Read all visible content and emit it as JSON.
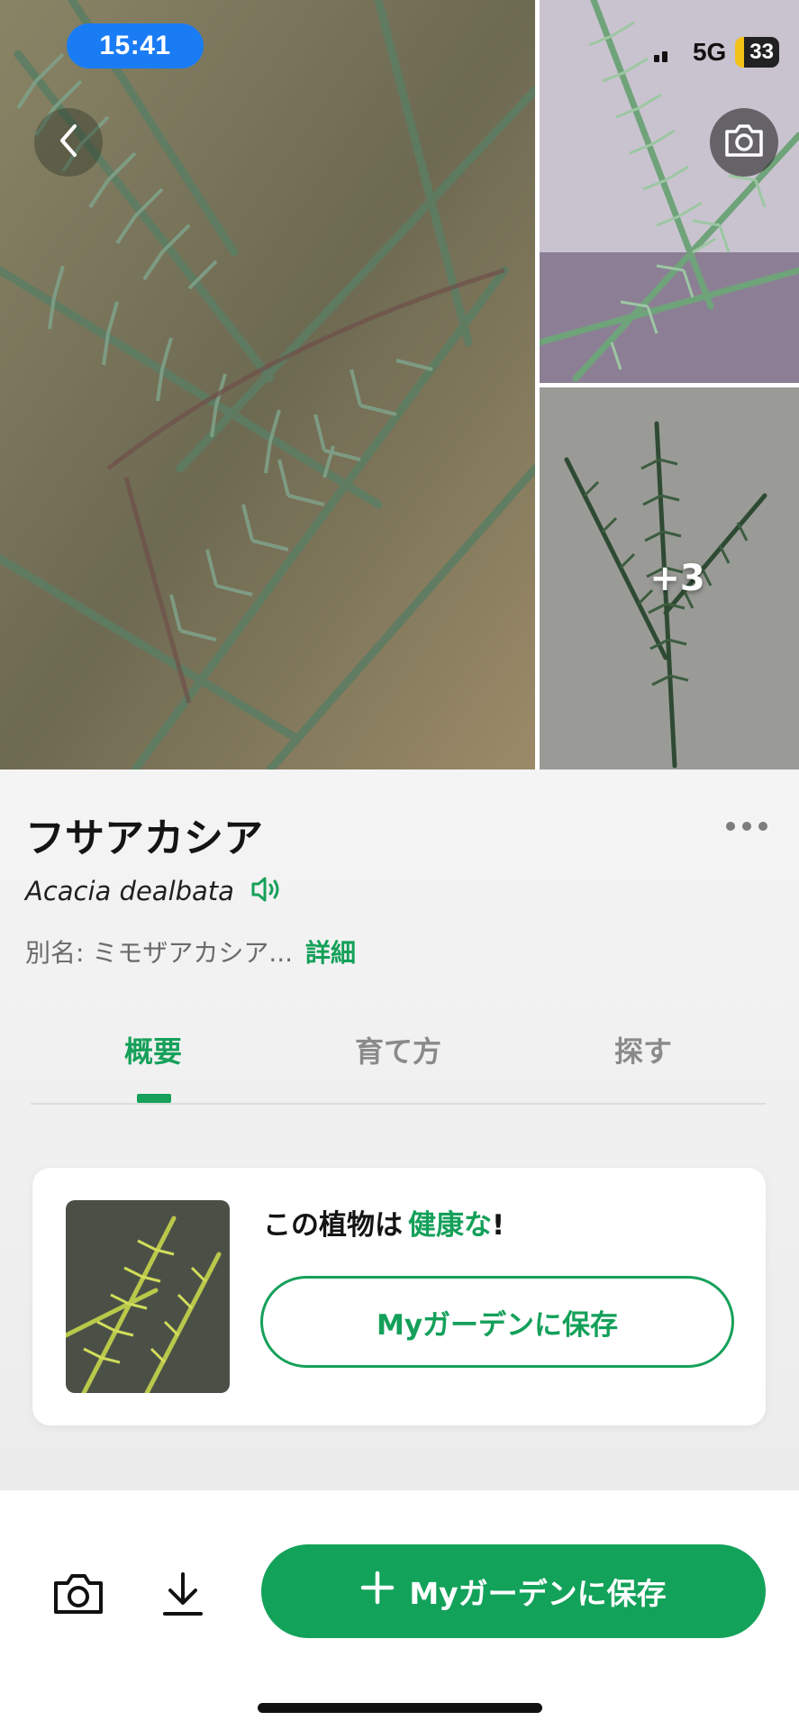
{
  "status_bar": {
    "time": "15:41",
    "network": "5G",
    "battery": "33"
  },
  "gallery": {
    "more_count": "+3"
  },
  "plant": {
    "common_name": "フサアカシア",
    "scientific_name": "Acacia dealbata",
    "alias": "別名: ミモザアカシア...",
    "detail_link": "詳細"
  },
  "tabs": [
    {
      "label": "概要",
      "active": true
    },
    {
      "label": "育て方",
      "active": false
    },
    {
      "label": "探す",
      "active": false
    }
  ],
  "health_card": {
    "prefix": "この植物は",
    "status_word": "健康な",
    "suffix": "!",
    "save_label": "Myガーデンに保存"
  },
  "bottom_bar": {
    "save_label": "Myガーデンに保存"
  },
  "colors": {
    "accent_green": "#13a25a",
    "time_pill": "#1a7cf5",
    "battery_low": "#f3c217"
  },
  "icons": [
    "back-chevron-icon",
    "camera-icon",
    "speaker-icon",
    "more-dots-icon",
    "download-icon",
    "plus-icon"
  ]
}
